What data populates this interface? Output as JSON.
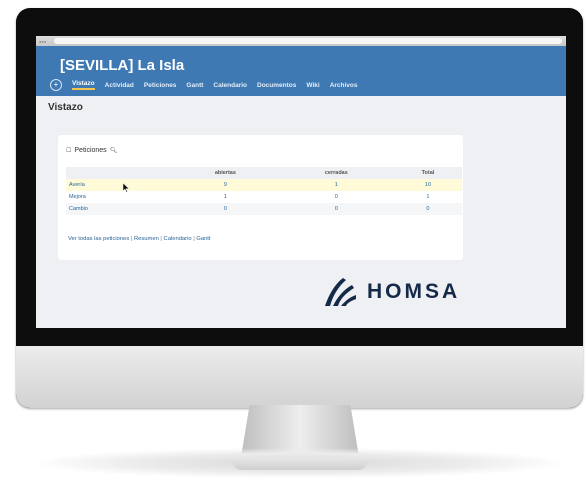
{
  "project": {
    "title": "[SEVILLA] La Isla"
  },
  "menu": {
    "items": [
      "Vistazo",
      "Actividad",
      "Peticiones",
      "Gantt",
      "Calendario",
      "Documentos",
      "Wiki",
      "Archivos"
    ],
    "selected": "Vistazo"
  },
  "page": {
    "title": "Vistazo"
  },
  "issues_box": {
    "title": "Peticiones",
    "columns": [
      "",
      "abiertas",
      "cerradas",
      "Total"
    ],
    "rows": [
      {
        "label": "Avería",
        "abiertas": "9",
        "cerradas": "1",
        "total": "10"
      },
      {
        "label": "Mejora",
        "abiertas": "1",
        "cerradas": "0",
        "total": "1"
      },
      {
        "label": "Cambio",
        "abiertas": "0",
        "cerradas": "0",
        "total": "0"
      }
    ],
    "links": [
      "Ver todas las peticiones",
      "Resumen",
      "Calendario",
      "Gantt"
    ]
  },
  "logo": {
    "text": "HOMSA",
    "color": "#152a48"
  },
  "colors": {
    "header": "#3e79b3",
    "accent": "#f5c44c",
    "link": "#2a6496"
  }
}
